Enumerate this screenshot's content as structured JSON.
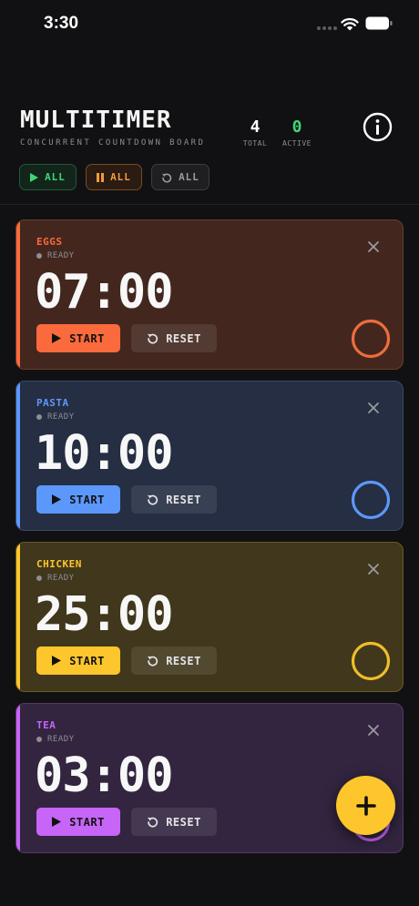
{
  "status_bar": {
    "time": "3:30"
  },
  "header": {
    "title": "MULTITIMER",
    "subtitle": "CONCURRENT COUNTDOWN BOARD",
    "stats": {
      "total_value": "4",
      "total_label": "TOTAL",
      "active_value": "0",
      "active_label": "ACTIVE"
    },
    "info_icon": "info-icon"
  },
  "bulk_actions": {
    "start_all_label": "ALL",
    "pause_all_label": "ALL",
    "reset_all_label": "ALL"
  },
  "timers": [
    {
      "name": "EGGS",
      "status": "READY",
      "time": "07:00",
      "start_label": "START",
      "reset_label": "RESET",
      "progress": 1.0,
      "accent": "#fb6a3c",
      "bg": "#43271e",
      "border": "#6b3c2c",
      "ring": "#ee6d3c"
    },
    {
      "name": "PASTA",
      "status": "READY",
      "time": "10:00",
      "start_label": "START",
      "reset_label": "RESET",
      "progress": 1.0,
      "accent": "#5c98fb",
      "bg": "#252e42",
      "border": "#384a6c",
      "ring": "#5c98fb"
    },
    {
      "name": "CHICKEN",
      "status": "READY",
      "time": "25:00",
      "start_label": "START",
      "reset_label": "RESET",
      "progress": 1.0,
      "accent": "#fdc62c",
      "bg": "#40371c",
      "border": "#6a5a24",
      "ring": "#f0bd2a"
    },
    {
      "name": "TEA",
      "status": "READY",
      "time": "03:00",
      "start_label": "START",
      "reset_label": "RESET",
      "progress": 1.0,
      "accent": "#c765f6",
      "bg": "#332540",
      "border": "#553866",
      "ring": "#c765f6"
    }
  ],
  "fab": {
    "icon": "plus-icon"
  },
  "colors": {
    "background": "#111113",
    "active_green": "#3ed774",
    "pause_orange": "#f39a3a",
    "fab_yellow": "#fdc62c"
  }
}
